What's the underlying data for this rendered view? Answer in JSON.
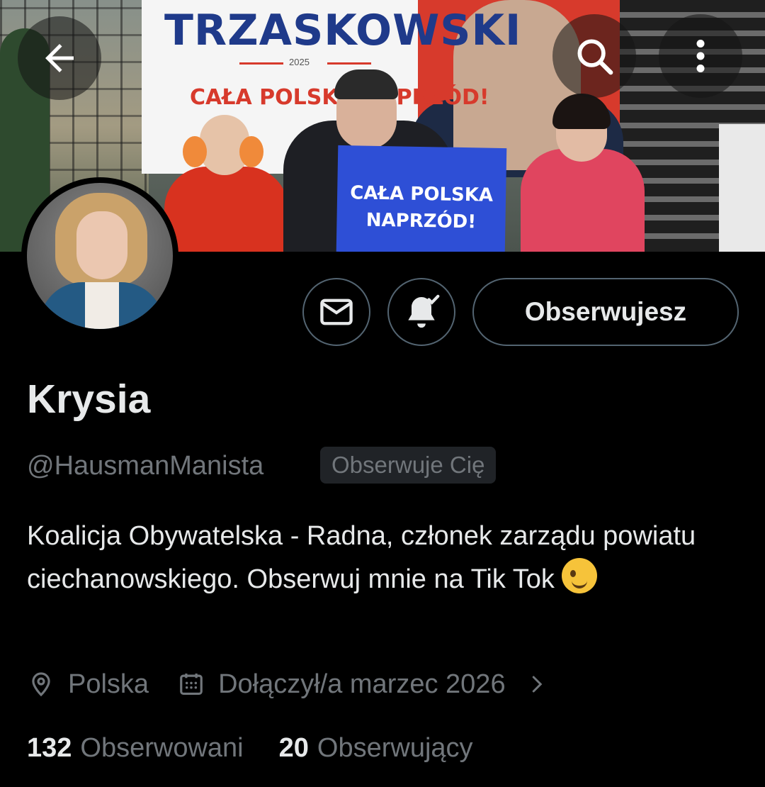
{
  "banner": {
    "poster_title": "TRZASKOWSKI",
    "poster_year": "2025",
    "poster_slogan": "CAŁA POLSKA NAPRZÓD!",
    "sign_line1": "CAŁA POLSKA",
    "sign_line2": "NAPRZÓD!"
  },
  "nav": {
    "back_icon": "arrow-left-icon",
    "search_icon": "search-icon",
    "more_icon": "more-vertical-icon"
  },
  "actions": {
    "message_icon": "envelope-icon",
    "notifications_icon": "bell-check-icon",
    "follow_label": "Obserwujesz"
  },
  "profile": {
    "name": "Krysia",
    "handle": "@HausmanManista",
    "follows_you_badge": "Obserwuje Cię",
    "bio": "Koalicja Obywatelska - Radna, członek zarządu powiatu ciechanowskiego. Obserwuj mnie na Tik Tok",
    "bio_emoji": "😉",
    "location": "Polska",
    "joined": "Dołączył/a marzec 2026"
  },
  "stats": {
    "following_count": "132",
    "following_label": "Obserwowani",
    "followers_count": "20",
    "followers_label": "Obserwujący"
  },
  "colors": {
    "background": "#000000",
    "text_primary": "#e7e9ea",
    "text_secondary": "#71767b",
    "border": "#536471"
  }
}
